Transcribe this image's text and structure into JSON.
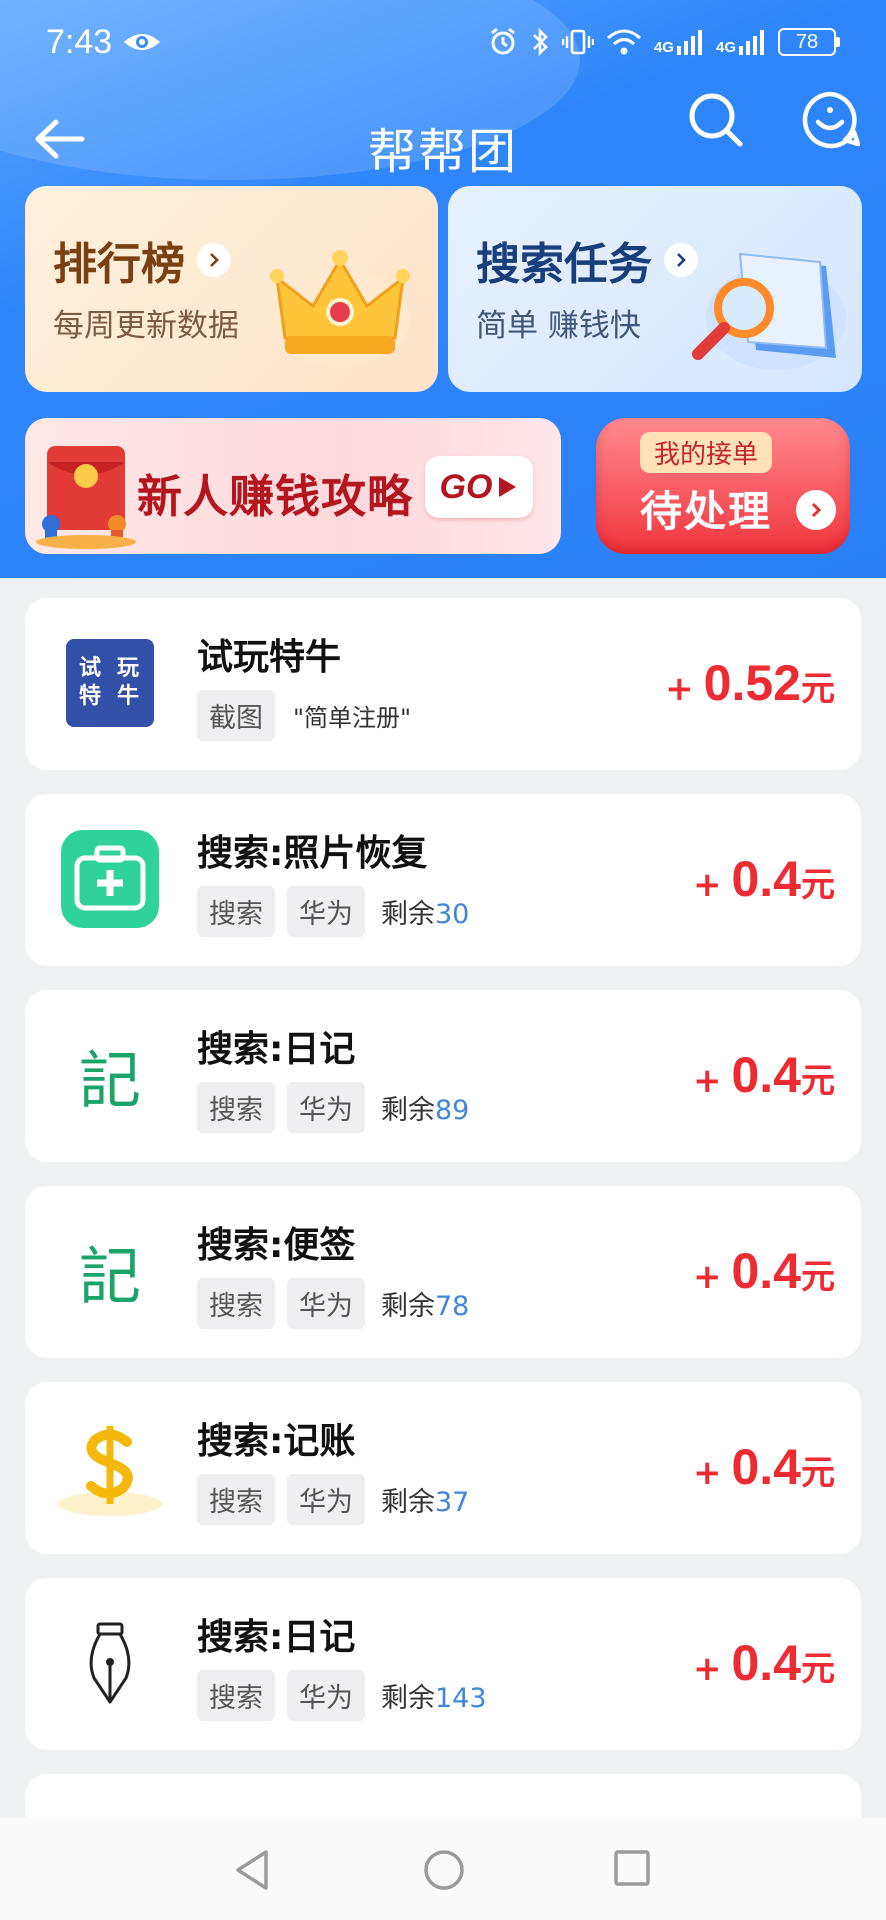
{
  "status_bar": {
    "time": "7:43",
    "battery": "78",
    "net1": "4G",
    "net2": "4G"
  },
  "header": {
    "title": "帮帮团"
  },
  "cards": {
    "rank": {
      "title": "排行榜",
      "subtitle": "每周更新数据"
    },
    "search": {
      "title": "搜索任务",
      "subtitle": "简单 赚钱快"
    }
  },
  "banners": {
    "guide": {
      "text": "新人赚钱攻略",
      "button": "GO"
    },
    "pending": {
      "badge": "我的接单",
      "text": "待处理"
    }
  },
  "icon_texts": {
    "try_play": [
      "试",
      "玩",
      "特",
      "牛"
    ],
    "diary": "記"
  },
  "tasks": [
    {
      "name": "试玩特牛",
      "tags": [
        "截图"
      ],
      "note": "\"简单注册\"",
      "reward_plus": "+",
      "reward": "0.52",
      "unit": "元"
    },
    {
      "name": "搜索:照片恢复",
      "tags": [
        "搜索",
        "华为"
      ],
      "remain_label": "剩余",
      "remain": "30",
      "reward_plus": "+",
      "reward": "0.4",
      "unit": "元"
    },
    {
      "name": "搜索:日记",
      "tags": [
        "搜索",
        "华为"
      ],
      "remain_label": "剩余",
      "remain": "89",
      "reward_plus": "+",
      "reward": "0.4",
      "unit": "元"
    },
    {
      "name": "搜索:便签",
      "tags": [
        "搜索",
        "华为"
      ],
      "remain_label": "剩余",
      "remain": "78",
      "reward_plus": "+",
      "reward": "0.4",
      "unit": "元"
    },
    {
      "name": "搜索:记账",
      "tags": [
        "搜索",
        "华为"
      ],
      "remain_label": "剩余",
      "remain": "37",
      "reward_plus": "+",
      "reward": "0.4",
      "unit": "元"
    },
    {
      "name": "搜索:日记",
      "tags": [
        "搜索",
        "华为"
      ],
      "remain_label": "剩余",
      "remain": "143",
      "reward_plus": "+",
      "reward": "0.4",
      "unit": "元"
    }
  ],
  "icons": [
    "eye-icon",
    "alarm-icon",
    "bluetooth-icon",
    "vibrate-icon",
    "wifi-icon",
    "signal-icon",
    "back-arrow-icon",
    "search-icon",
    "chat-icon",
    "crown-icon",
    "magnifier-icon",
    "envelope-icon",
    "medical-kit-icon",
    "dollar-icon",
    "fountain-pen-icon"
  ]
}
